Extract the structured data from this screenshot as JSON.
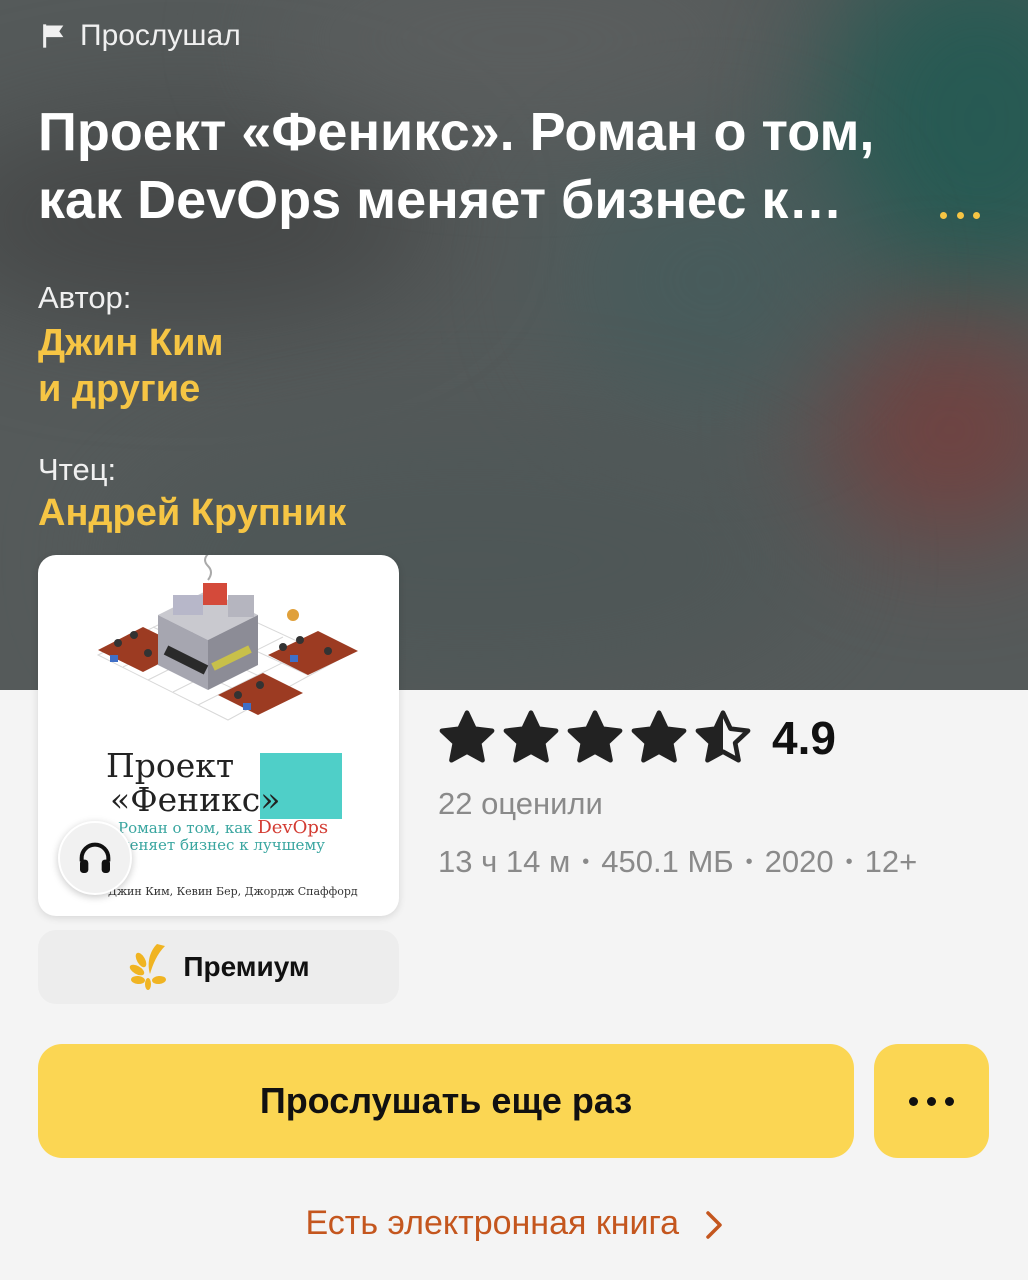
{
  "status": {
    "label": "Прослушал",
    "icon": "flag-icon"
  },
  "book": {
    "title": "Проект «Феникс». Роман о том, как DevOps меняет бизнес к лучшему",
    "author_label": "Автор:",
    "author_line1": "Джин Ким",
    "author_line2": "и другие",
    "narrator_label": "Чтец:",
    "narrator": "Андрей Крупник"
  },
  "cover": {
    "title_line1": "Проект",
    "title_line2": "«Феникс»",
    "subtitle_prefix": "Роман о том, как",
    "subtitle_devops": "DevOps",
    "subtitle_suffix": "меняет бизнес к лучшему",
    "authors": "Джин Ким, Кевин Бер, Джордж Спаффорд"
  },
  "premium": {
    "label": "Премиум",
    "icon": "laurel-icon"
  },
  "rating": {
    "value": "4.9",
    "stars": 4.5,
    "count_text": "22 оценили"
  },
  "details": {
    "duration": "13 ч 14 м",
    "size": "450.1 МБ",
    "year": "2020",
    "age": "12+"
  },
  "actions": {
    "listen_label": "Прослушать еще раз",
    "more_icon": "more-dots-icon"
  },
  "ebook": {
    "label": "Есть электронная книга"
  },
  "colors": {
    "accent": "#fbd653",
    "link_yellow": "#f6c544",
    "ebook_link": "#c4561e"
  }
}
